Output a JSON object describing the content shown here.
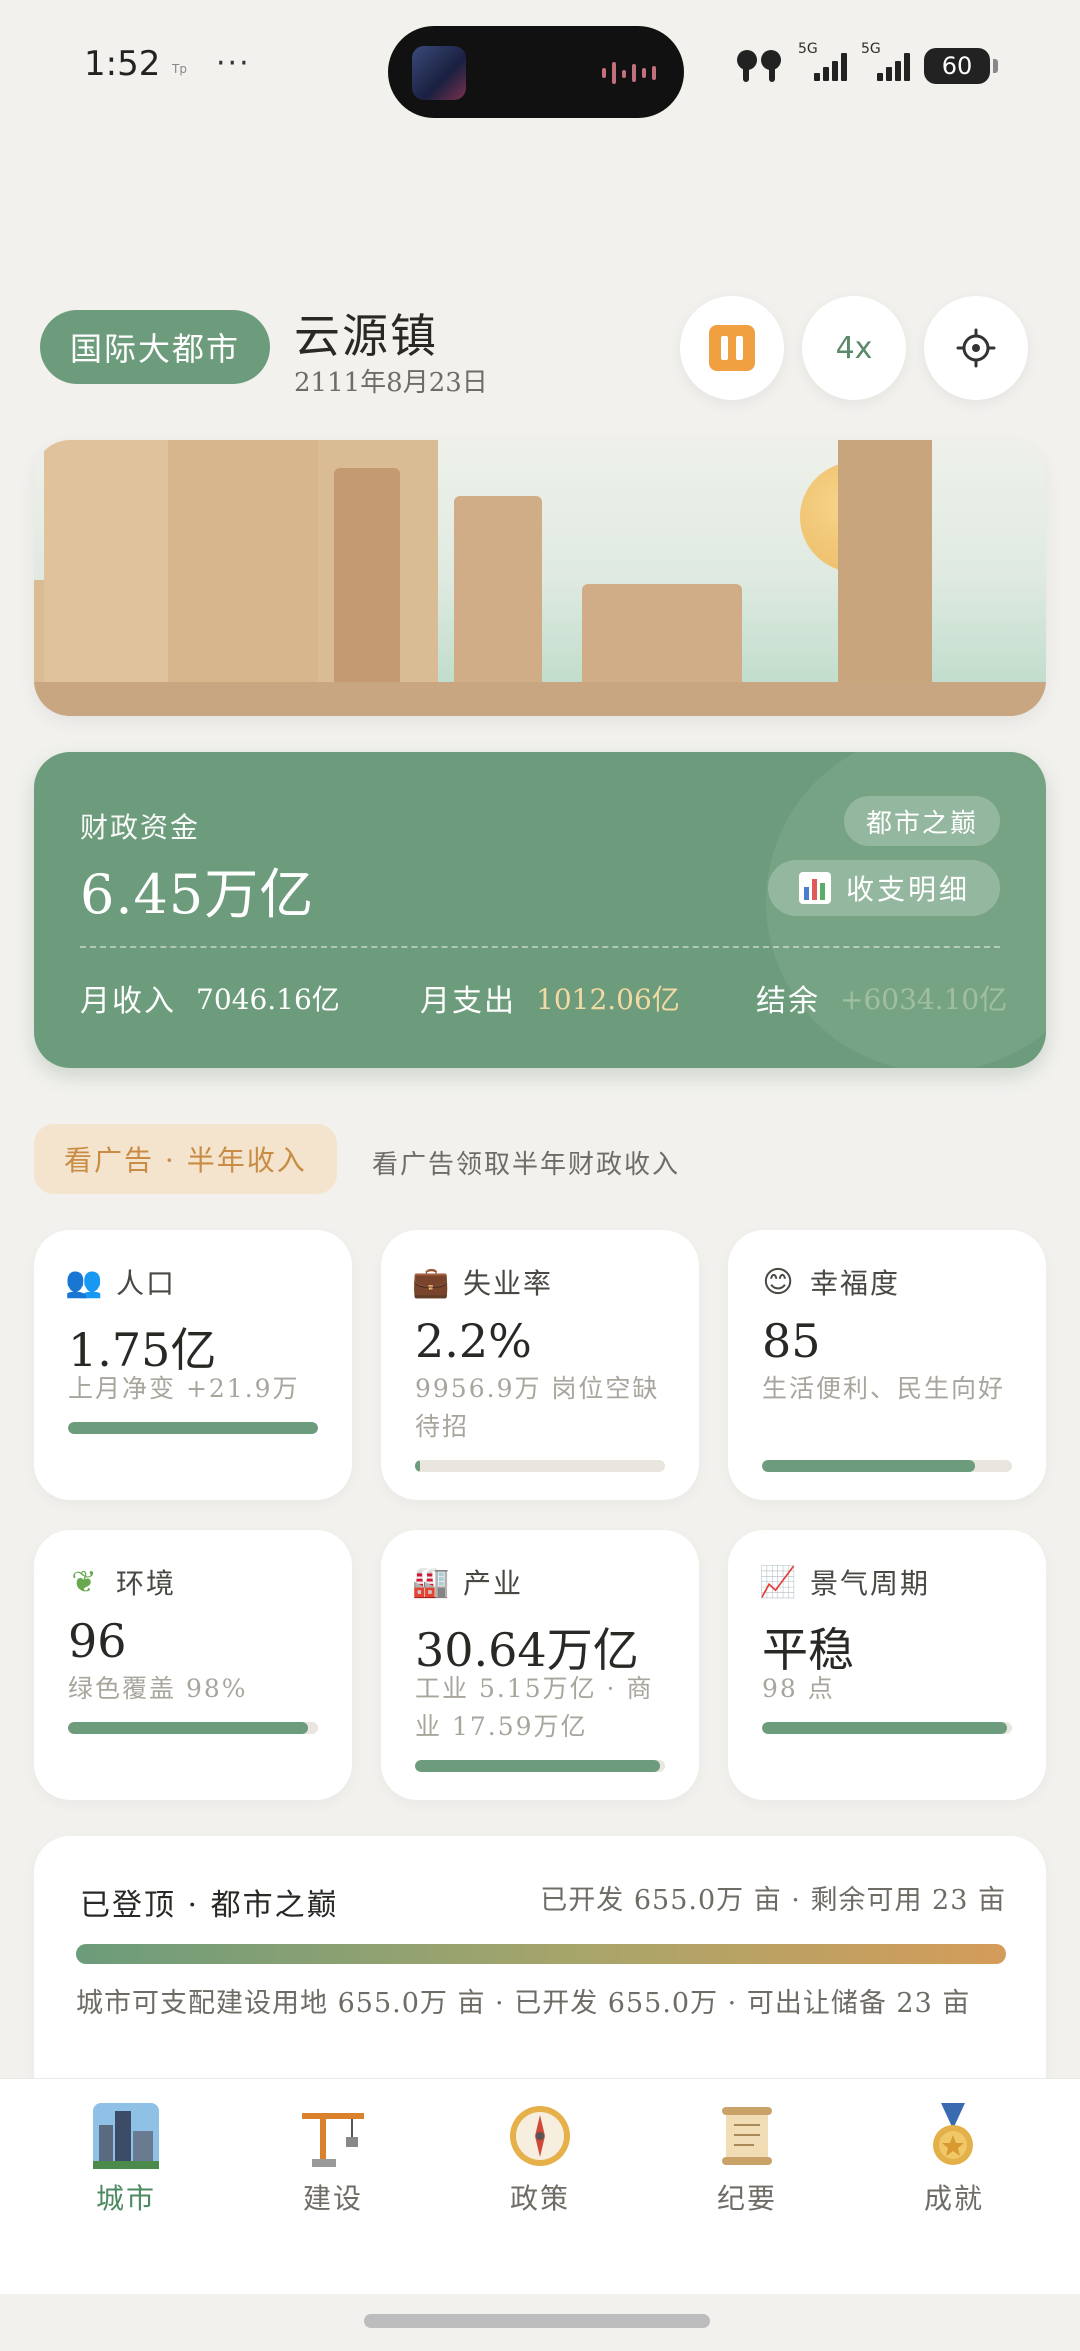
{
  "status_bar": {
    "time": "1:52",
    "tp_label": "Tp",
    "more": "···",
    "network_label": "5G",
    "battery": "60"
  },
  "header": {
    "city_level": "国际大都市",
    "city_name": "云源镇",
    "date": "2111年8月23日",
    "speed": "4x"
  },
  "finance": {
    "label": "财政资金",
    "value": "6.45万亿",
    "tier": "都市之巅",
    "detail_button": "收支明细",
    "income_label": "月收入",
    "income_value": "7046.16亿",
    "expense_label": "月支出",
    "expense_value": "1012.06亿",
    "balance_label": "结余",
    "balance_value": "+6034.10亿",
    "colors": {
      "card": "#6c9c7b",
      "expense": "#f3d9a4",
      "balance": "#9fbf9f"
    }
  },
  "ad": {
    "button": "看广告 · 半年收入",
    "text": "看广告领取半年财政收入"
  },
  "stats": [
    {
      "icon": "people-icon",
      "title": "人口",
      "value": "1.75亿",
      "sub": "上月净变 +21.9万",
      "progress": 1.0
    },
    {
      "icon": "briefcase-icon",
      "title": "失业率",
      "value": "2.2%",
      "sub": "9956.9万 岗位空缺待招",
      "progress": 0.022
    },
    {
      "icon": "smile-icon",
      "title": "幸福度",
      "value": "85",
      "sub": "生活便利、民生向好",
      "progress": 0.85
    },
    {
      "icon": "leaf-icon",
      "title": "环境",
      "value": "96",
      "sub": "绿色覆盖 98%",
      "progress": 0.96
    },
    {
      "icon": "factory-icon",
      "title": "产业",
      "value": "30.64万亿",
      "sub": "工业 5.15万亿 · 商业 17.59万亿",
      "progress": 0.98
    },
    {
      "icon": "chart-up-icon",
      "title": "景气周期",
      "value": "平稳",
      "sub": "98 点",
      "progress": 0.98
    }
  ],
  "land": {
    "title": "已登顶 · 都市之巅",
    "summary": "已开发 655.0万 亩 · 剩余可用 23 亩",
    "description": "城市可支配建设用地 655.0万 亩 · 已开发 655.0万 · 可出让储备 23 亩",
    "progress": 1.0
  },
  "tabs": [
    {
      "label": "城市",
      "icon": "city-icon",
      "active": true
    },
    {
      "label": "建设",
      "icon": "crane-icon",
      "active": false
    },
    {
      "label": "政策",
      "icon": "compass-icon",
      "active": false
    },
    {
      "label": "纪要",
      "icon": "scroll-icon",
      "active": false
    },
    {
      "label": "成就",
      "icon": "medal-icon",
      "active": false
    }
  ]
}
